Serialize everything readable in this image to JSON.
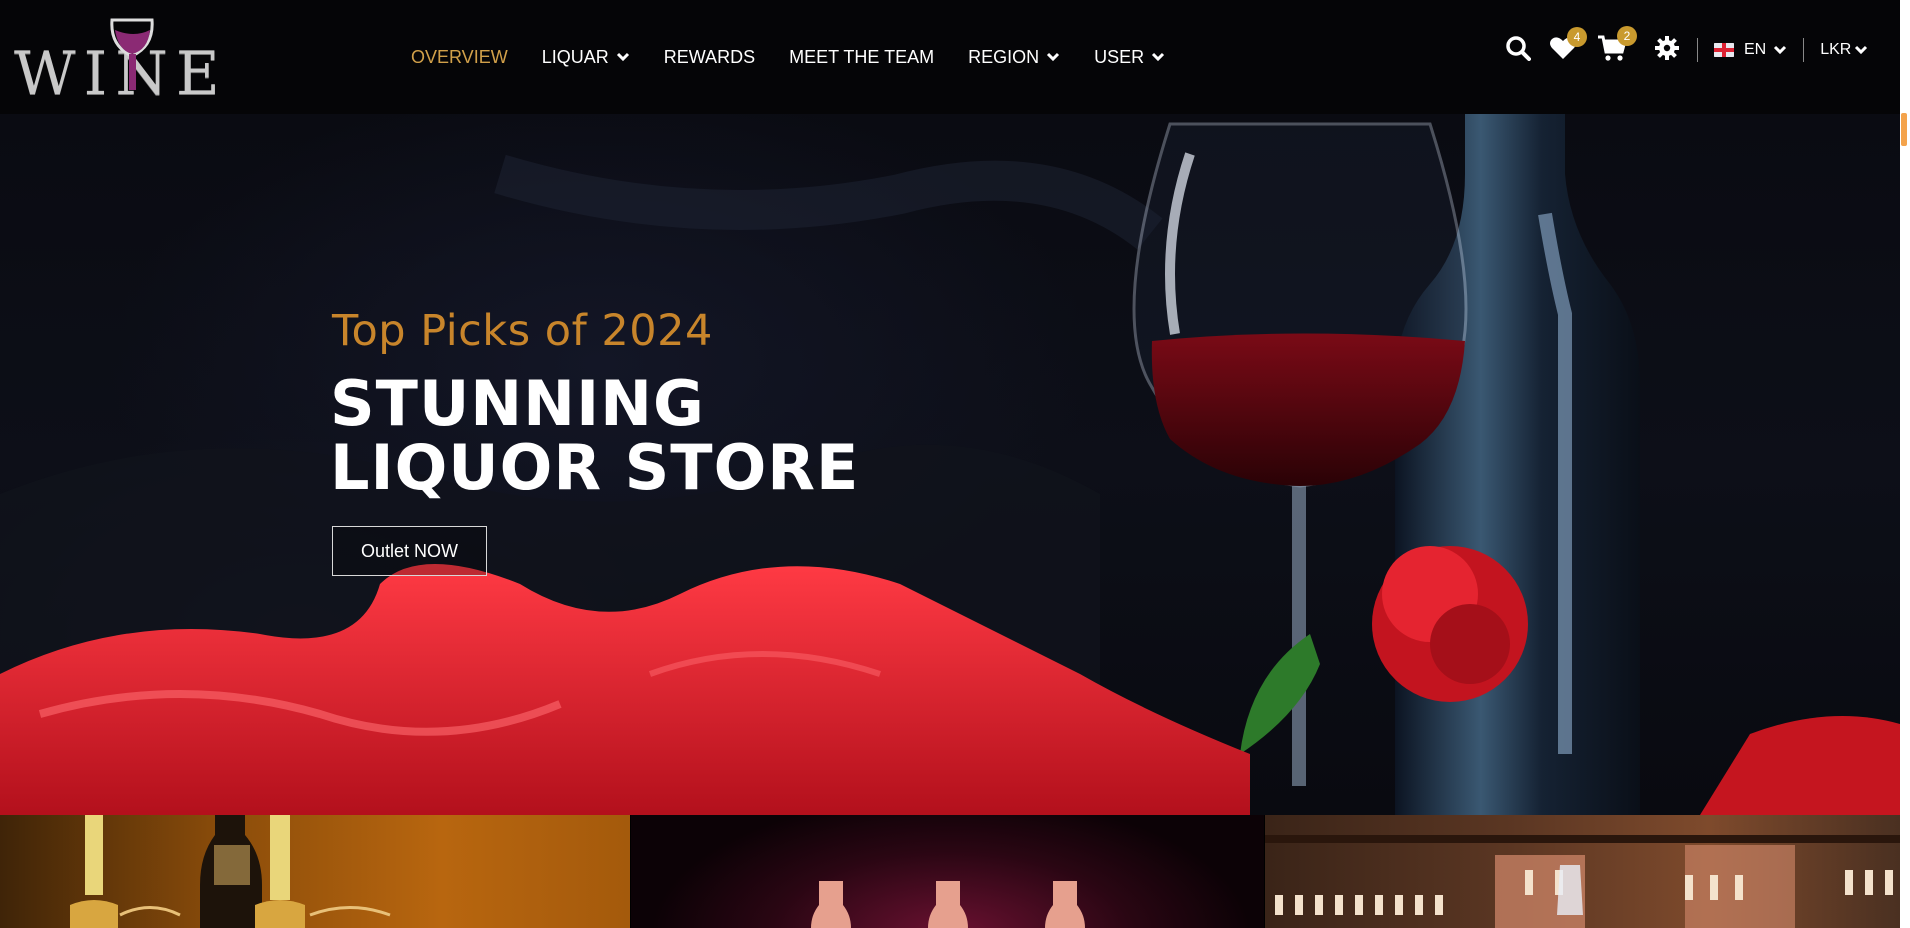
{
  "logo": {
    "text": "WINE"
  },
  "nav": {
    "items": [
      {
        "label": "OVERVIEW",
        "active": true,
        "dropdown": false
      },
      {
        "label": "LIQUAR",
        "active": false,
        "dropdown": true
      },
      {
        "label": "REWARDS",
        "active": false,
        "dropdown": false
      },
      {
        "label": "MEET THE TEAM",
        "active": false,
        "dropdown": false
      },
      {
        "label": "REGION",
        "active": false,
        "dropdown": true
      },
      {
        "label": "USER",
        "active": false,
        "dropdown": true
      }
    ]
  },
  "tools": {
    "search_icon": "search-icon",
    "wishlist_icon": "heart-icon",
    "wishlist_count": "4",
    "cart_icon": "cart-icon",
    "cart_count": "2",
    "settings_icon": "gear-icon",
    "language": "EN",
    "currency": "LKR"
  },
  "hero": {
    "subtitle": "Top Picks of 2024",
    "title_line1": "STUNNING",
    "title_line2": "LIQUOR STORE",
    "button_label": "Outlet NOW"
  },
  "colors": {
    "accent": "#d1a04a",
    "subtitle": "#c8852b",
    "badge": "#c99a2e",
    "header_bg": "#050507",
    "scroll_thumb": "#f4a34b"
  }
}
